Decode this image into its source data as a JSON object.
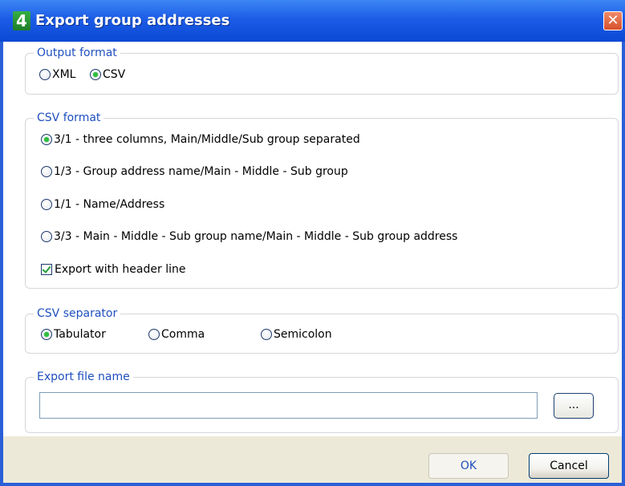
{
  "window": {
    "title": "Export group addresses",
    "app_icon_glyph": "4",
    "close_glyph": "✕"
  },
  "output_format": {
    "legend": "Output format",
    "options": [
      {
        "label": "XML",
        "checked": false
      },
      {
        "label": "CSV",
        "checked": true
      }
    ]
  },
  "csv_format": {
    "legend": "CSV format",
    "options": [
      {
        "label": "3/1 - three columns, Main/Middle/Sub group separated",
        "checked": true
      },
      {
        "label": "1/3 - Group address name/Main - Middle - Sub group",
        "checked": false
      },
      {
        "label": "1/1 - Name/Address",
        "checked": false
      },
      {
        "label": "3/3 - Main - Middle - Sub group name/Main - Middle - Sub group address",
        "checked": false
      }
    ],
    "header_line": {
      "label": "Export with header line",
      "checked": true
    }
  },
  "csv_separator": {
    "legend": "CSV separator",
    "options": [
      {
        "label": "Tabulator",
        "checked": true
      },
      {
        "label": "Comma",
        "checked": false
      },
      {
        "label": "Semicolon",
        "checked": false
      }
    ]
  },
  "export_file": {
    "legend": "Export file name",
    "value": "",
    "browse_label": "..."
  },
  "buttons": {
    "ok": "OK",
    "cancel": "Cancel"
  },
  "colors": {
    "title_bar": "#1c5ce6",
    "legend_text": "#1f4fbf",
    "radio_dot": "#2fbf3f",
    "footer": "#ece9d8"
  }
}
